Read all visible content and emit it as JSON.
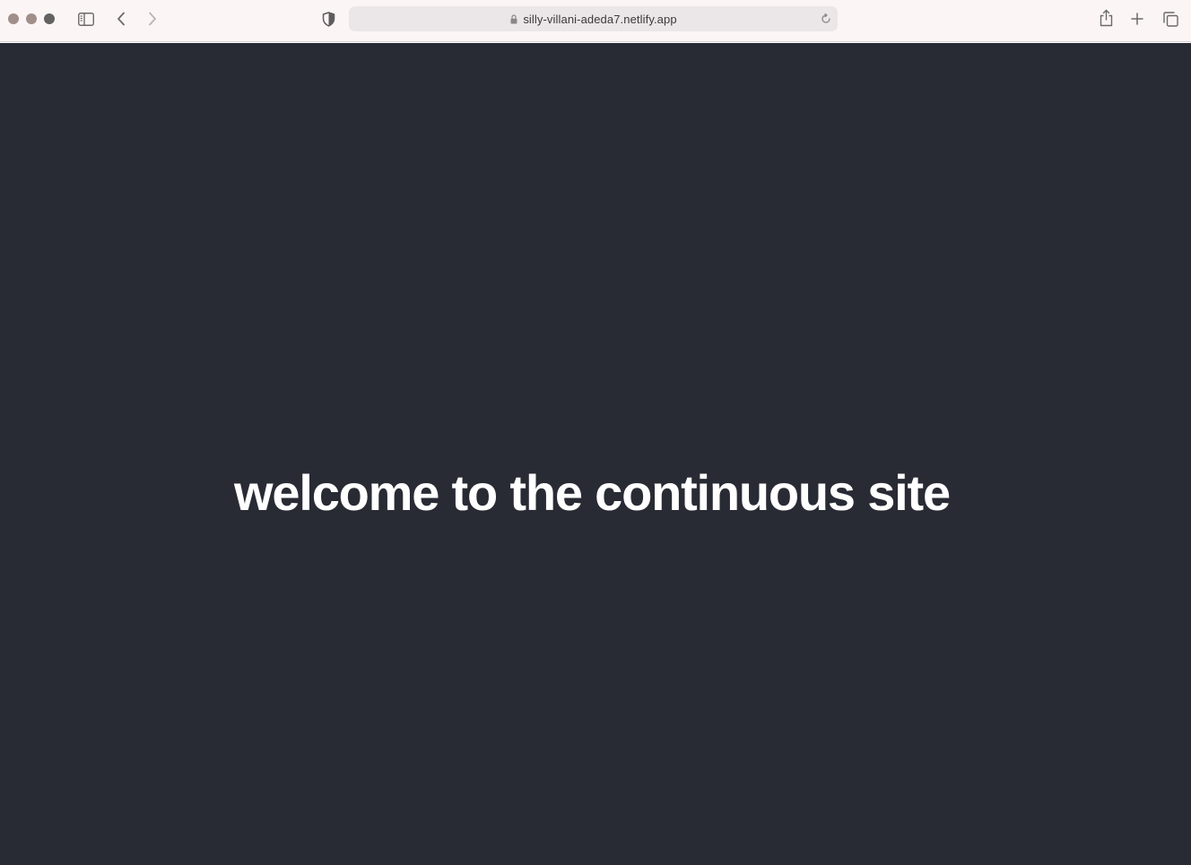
{
  "browser": {
    "url": "silly-villani-adeda7.netlify.app",
    "toolbar_icons": {
      "sidebar": "sidebar-toggle-icon",
      "back": "chevron-left-icon",
      "forward": "chevron-right-icon",
      "privacy": "shield-icon",
      "lock": "lock-icon",
      "reload": "reload-icon",
      "share": "share-icon",
      "new_tab": "plus-icon",
      "tab_overview": "tabs-overview-icon"
    },
    "colors": {
      "toolbar_bg": "#fbf5f6",
      "address_bg": "#ebe6e7",
      "traffic_light": "#a08f89",
      "traffic_light_active": "#636262"
    }
  },
  "page": {
    "headline": "welcome to the continuous site",
    "colors": {
      "background": "#292b34",
      "text": "#ffffff"
    }
  }
}
